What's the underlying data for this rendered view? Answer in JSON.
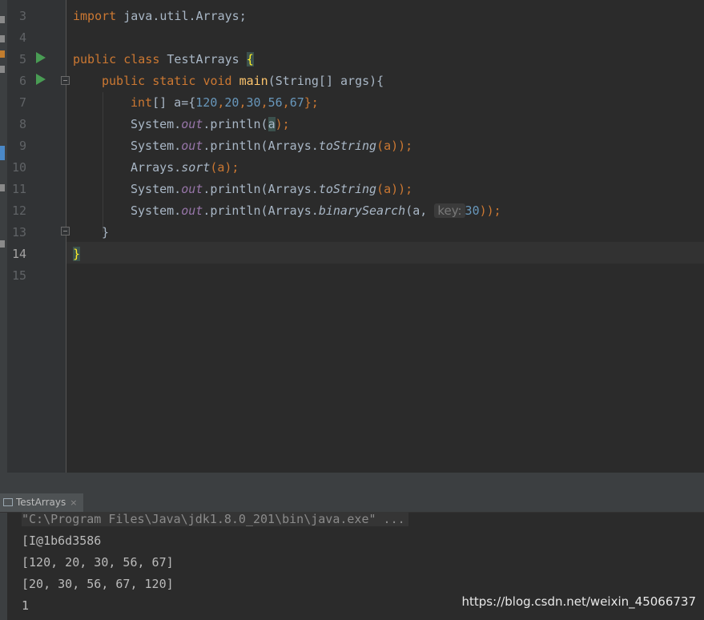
{
  "editor": {
    "line_numbers": [
      "3",
      "4",
      "5",
      "6",
      "7",
      "8",
      "9",
      "10",
      "11",
      "12",
      "13",
      "14",
      "15"
    ],
    "lines": {
      "l3": {
        "kw_import": "import",
        "rest": " java.util.Arrays;"
      },
      "l5": {
        "kw_public": "public",
        "kw_class": "class",
        "class_name": "TestArrays",
        "brace": "{"
      },
      "l6": {
        "kw_public": "public",
        "kw_static": "static",
        "kw_void": "void",
        "method": "main",
        "sig": "(String[] args){"
      },
      "l7": {
        "kw_int": "int",
        "a": "[] a={",
        "n1": "120",
        "n2": "20",
        "n3": "30",
        "n4": "56",
        "n5": "67",
        "end": "};"
      },
      "l8": {
        "sys": "System.",
        "out": "out",
        "call": ".println(",
        "arg": "a",
        "end": ");"
      },
      "l9": {
        "sys": "System.",
        "out": "out",
        "call": ".println(Arrays.",
        "fn": "toString",
        "end": "(a));"
      },
      "l10": {
        "sys": "Arrays.",
        "fn": "sort",
        "end": "(a);"
      },
      "l11": {
        "sys": "System.",
        "out": "out",
        "call": ".println(Arrays.",
        "fn": "toString",
        "end": "(a));"
      },
      "l12": {
        "sys": "System.",
        "out": "out",
        "call": ".println(Arrays.",
        "fn": "binarySearch",
        "pre": "(a, ",
        "hint": "key:",
        "num": "30",
        "end": "));"
      },
      "l13": {
        "text": "}"
      },
      "l14": {
        "text": "}"
      }
    }
  },
  "run_panel": {
    "tab_label": "TestArrays",
    "tab_close": "×",
    "output": [
      "\"C:\\Program Files\\Java\\jdk1.8.0_201\\bin\\java.exe\" ...",
      "[I@1b6d3586",
      "[120, 20, 30, 56, 67]",
      "[20, 30, 56, 67, 120]",
      "1"
    ]
  },
  "watermark": "https://blog.csdn.net/weixin_45066737",
  "colors": {
    "keyword": "#cc7832",
    "method": "#ffc66d",
    "number": "#6897bb",
    "field": "#9876aa",
    "run_icon": "#499c54"
  }
}
